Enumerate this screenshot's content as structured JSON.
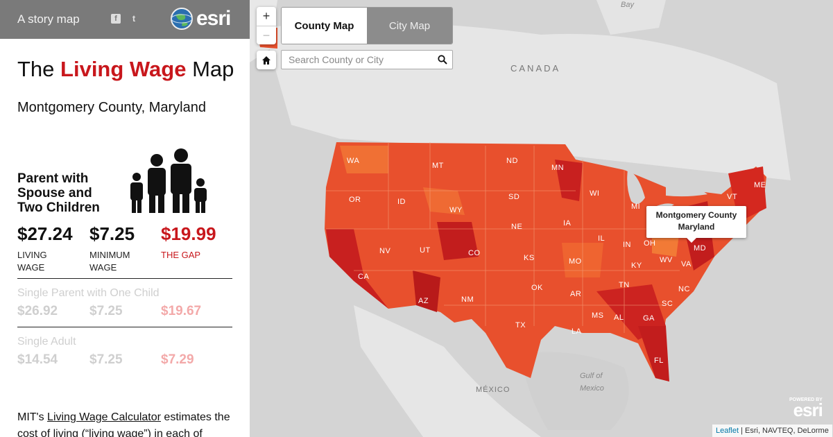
{
  "topbar": {
    "story_label": "A story map",
    "social": [
      "facebook-icon",
      "twitter-icon"
    ],
    "logo_text": "esri"
  },
  "title": {
    "prefix": "The ",
    "highlight": "Living Wage",
    "suffix": " Map"
  },
  "place": "Montgomery County, Maryland",
  "family": {
    "label": "Parent with Spouse and Two Children",
    "living_wage": "$27.24",
    "living_wage_label": "LIVING WAGE",
    "minimum_wage": "$7.25",
    "minimum_wage_label": "MINIMUM WAGE",
    "gap": "$19.99",
    "gap_label": "THE GAP"
  },
  "single_parent": {
    "label": "Single Parent with One Child",
    "living_wage": "$26.92",
    "minimum_wage": "$7.25",
    "gap": "$19.67"
  },
  "single_adult": {
    "label": "Single Adult",
    "living_wage": "$14.54",
    "minimum_wage": "$7.25",
    "gap": "$7.29"
  },
  "description": {
    "prefix": "MIT's ",
    "link": "Living Wage Calculator",
    "suffix": " estimates the cost of living (“living wage”) in each of"
  },
  "map": {
    "zoom_in": "+",
    "zoom_out": "−",
    "tabs": [
      {
        "label": "County Map",
        "active": true
      },
      {
        "label": "City Map",
        "active": false
      }
    ],
    "search_placeholder": "Search County or City",
    "popup_line1": "Montgomery County",
    "popup_line2": "Maryland",
    "labels": {
      "canada": "CANADA",
      "mexico": "MÉXICO",
      "gulf1": "Gulf of",
      "gulf2": "Mexico",
      "bay": "Bay"
    },
    "states": [
      "WA",
      "MT",
      "ND",
      "MN",
      "OR",
      "ID",
      "SD",
      "WI",
      "MI",
      "VT",
      "ME",
      "WY",
      "NE",
      "IA",
      "IL",
      "IN",
      "OH",
      "NV",
      "UT",
      "CO",
      "KS",
      "MO",
      "KY",
      "WV",
      "VA",
      "CA",
      "OK",
      "TN",
      "NC",
      "AZ",
      "NM",
      "AR",
      "SC",
      "MS",
      "AL",
      "GA",
      "TX",
      "LA",
      "FL",
      "MD"
    ],
    "powered_small": "POWERED BY",
    "powered_big": "esri",
    "attribution_link": "Leaflet",
    "attribution_text": " | Esri, NAVTEQ, DeLorme"
  },
  "colors": {
    "accent_red": "#c8171c",
    "topbar_gray": "#7a7a7a",
    "map_base": "#d6d6d6"
  }
}
